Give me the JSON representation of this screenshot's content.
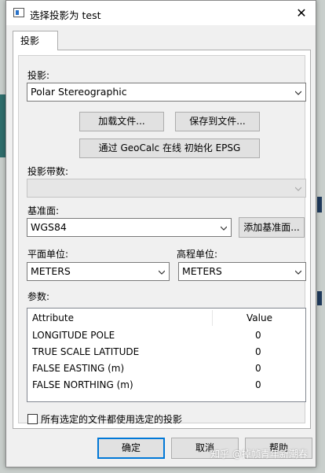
{
  "dialog": {
    "title": "选择投影为 test",
    "close_glyph": "✕"
  },
  "tab": {
    "label": "投影"
  },
  "projection": {
    "label": "投影:",
    "value": "Polar Stereographic",
    "load_button": "加载文件...",
    "save_button": "保存到文件...",
    "geocalc_button": "通过 GeoCalc 在线  初始化 EPSG"
  },
  "zone": {
    "label": "投影带数:",
    "value": ""
  },
  "datum": {
    "label": "基准面:",
    "value": "WGS84",
    "add_button": "添加基准面..."
  },
  "planar_units": {
    "label": "平面单位:",
    "value": "METERS"
  },
  "elevation_units": {
    "label": "高程单位:",
    "value": "METERS"
  },
  "params": {
    "label": "参数:",
    "columns": [
      "Attribute",
      "Value"
    ],
    "rows": [
      {
        "attribute": "LONGITUDE POLE",
        "value": "0"
      },
      {
        "attribute": "TRUE SCALE LATITUDE",
        "value": "0"
      },
      {
        "attribute": "FALSE EASTING (m)",
        "value": "0"
      },
      {
        "attribute": "FALSE NORTHING (m)",
        "value": "0"
      }
    ]
  },
  "apply_all": {
    "label": "所有选定的文件都使用选定的投影",
    "checked": false
  },
  "footer": {
    "ok": "确定",
    "cancel": "取消",
    "help": "帮助"
  },
  "watermark": "知乎 @掉帧青年新潮春"
}
